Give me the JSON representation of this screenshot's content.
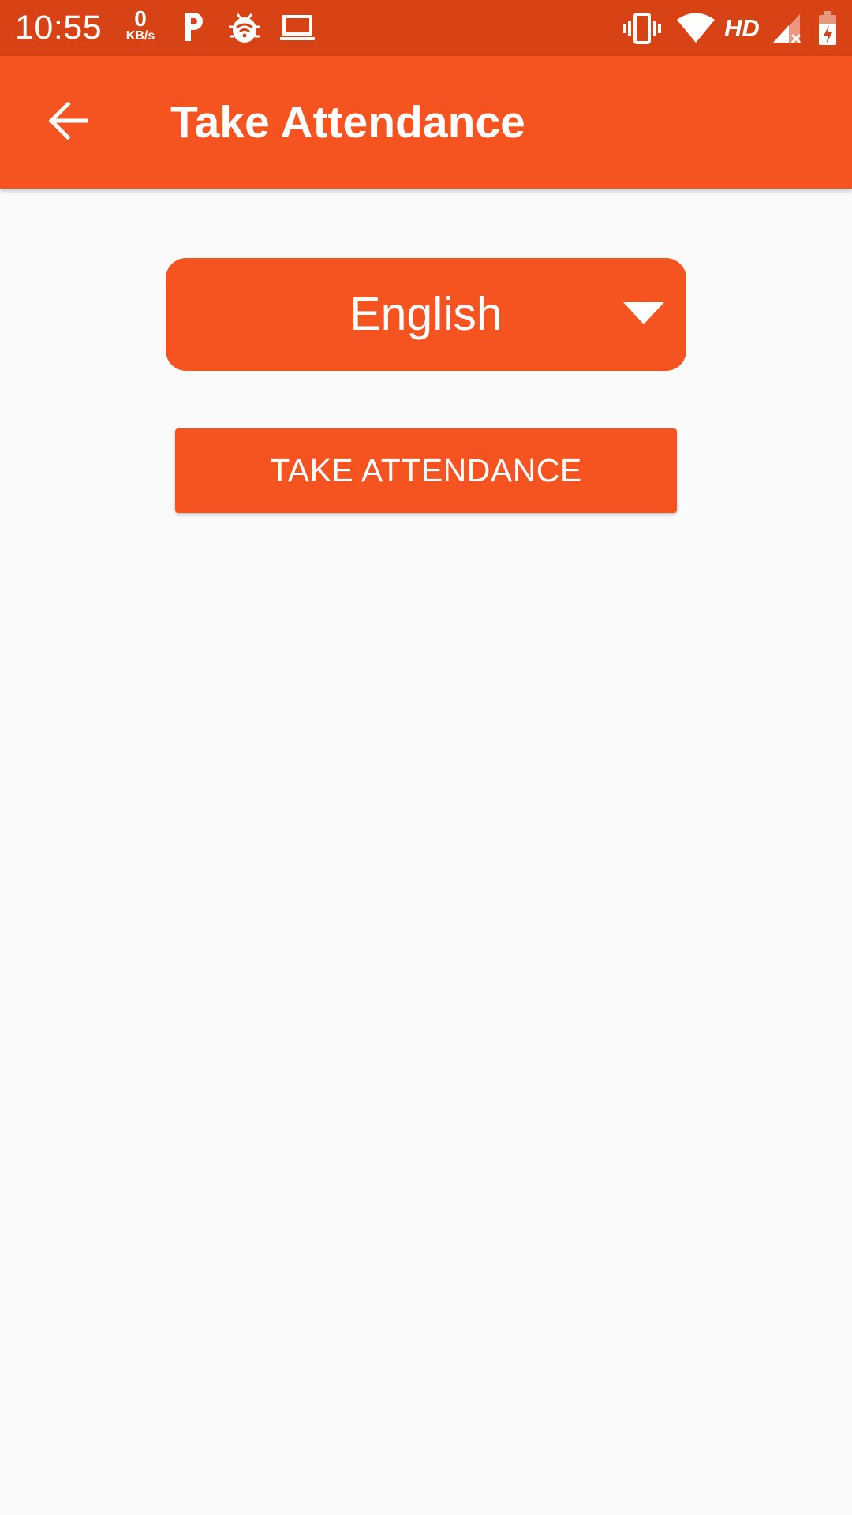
{
  "status_bar": {
    "time": "10:55",
    "net_speed_value": "0",
    "net_speed_unit": "KB/s",
    "network_label": "HD",
    "icons": [
      "parking-icon",
      "bug-wifi-icon",
      "laptop-icon",
      "vibrate-icon",
      "wifi-icon",
      "signal-no-data-icon",
      "battery-charging-icon"
    ],
    "background_color": "#D84315"
  },
  "app_bar": {
    "title": "Take Attendance",
    "back_icon": "arrow-back-icon",
    "background_color": "#F55420"
  },
  "language_select": {
    "selected": "English",
    "icon": "dropdown-triangle-icon"
  },
  "actions": {
    "take_attendance_label": "TAKE ATTENDANCE"
  },
  "colors": {
    "accent": "#F55420",
    "page_background": "#FAFAFA",
    "text_on_accent": "#FFFFFF"
  }
}
